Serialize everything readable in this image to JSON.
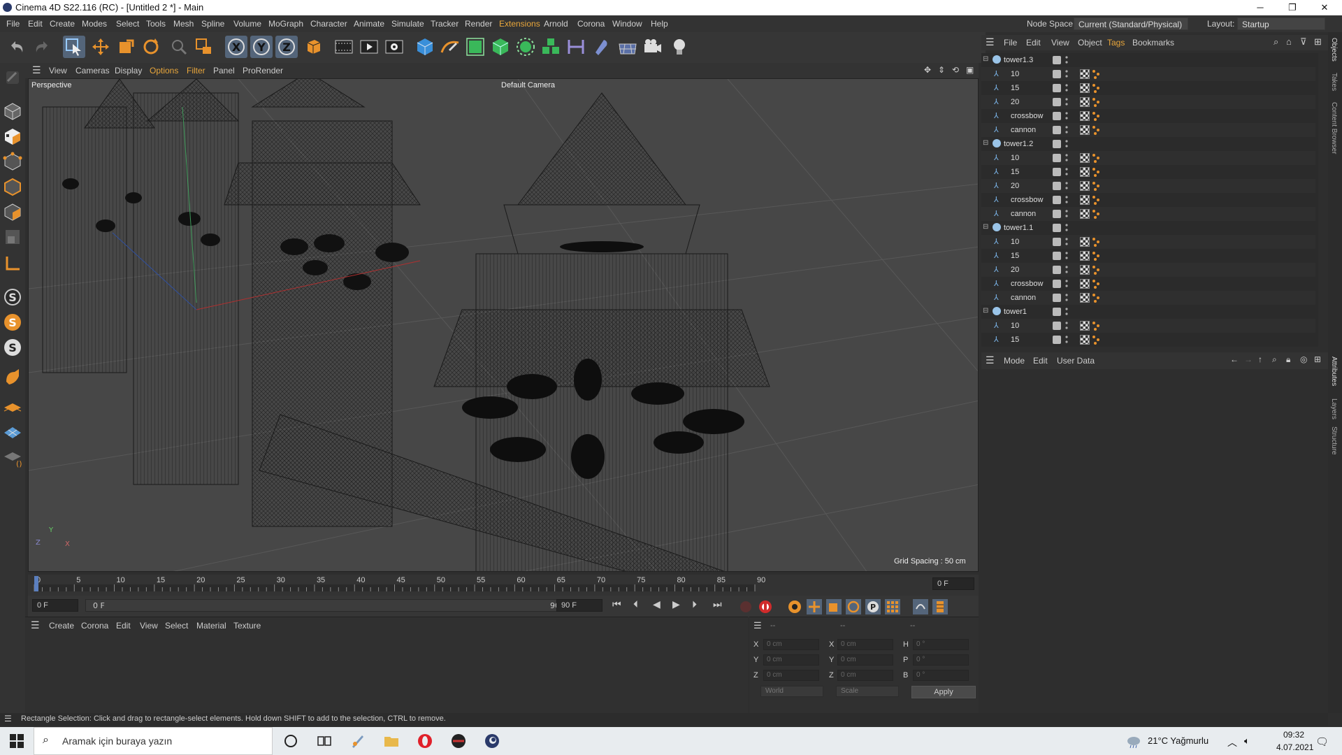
{
  "window": {
    "title": "Cinema 4D S22.116 (RC) - [Untitled 2 *] - Main",
    "controls": [
      "─",
      "❐",
      "✕"
    ]
  },
  "menubar": {
    "items": [
      "File",
      "Edit",
      "Create",
      "Modes",
      "Select",
      "Tools",
      "Mesh",
      "Spline",
      "Volume",
      "MoGraph",
      "Character",
      "Animate",
      "Simulate",
      "Tracker",
      "Render",
      "Extensions",
      "Arnold",
      "Corona",
      "Window",
      "Help"
    ],
    "node_space_label": "Node Space:",
    "node_space_value": "Current (Standard/Physical)",
    "layout_label": "Layout:",
    "layout_value": "Startup"
  },
  "viewport": {
    "menu": [
      "View",
      "Cameras",
      "Display",
      "Options",
      "Filter",
      "Panel",
      "ProRender"
    ],
    "view_name": "Perspective",
    "camera": "Default Camera",
    "grid_spacing": "Grid Spacing : 50 cm",
    "axis": {
      "y": "Y",
      "z": "Z",
      "x": "X"
    }
  },
  "timeline": {
    "ticks": [
      "0",
      "5",
      "10",
      "15",
      "20",
      "25",
      "30",
      "35",
      "40",
      "45",
      "50",
      "55",
      "60",
      "65",
      "70",
      "75",
      "80",
      "85",
      "90"
    ],
    "current_frame_display": "0 F"
  },
  "transport": {
    "start": "0 F",
    "range_start": "0 F",
    "range_end": "90 F",
    "end": "90 F"
  },
  "material_manager": {
    "menu": [
      "Create",
      "Corona",
      "Edit",
      "View",
      "Select",
      "Material",
      "Texture"
    ]
  },
  "coordinates": {
    "headers": [
      "--",
      "--",
      "--"
    ],
    "rows": [
      {
        "a": "X",
        "a_val": "0 cm",
        "b": "X",
        "b_val": "0 cm",
        "c": "H",
        "c_val": "0 °"
      },
      {
        "a": "Y",
        "a_val": "0 cm",
        "b": "Y",
        "b_val": "0 cm",
        "c": "P",
        "c_val": "0 °"
      },
      {
        "a": "Z",
        "a_val": "0 cm",
        "b": "Z",
        "b_val": "0 cm",
        "c": "B",
        "c_val": "0 °"
      }
    ],
    "mode": "World",
    "size_mode": "Scale",
    "apply": "Apply"
  },
  "status": {
    "text": "Rectangle Selection: Click and drag to rectangle-select elements. Hold down SHIFT to add to the selection, CTRL to remove."
  },
  "objects_panel": {
    "menu": [
      "File",
      "Edit",
      "View",
      "Object",
      "Tags",
      "Bookmarks"
    ],
    "rows": [
      {
        "label": "tower1.3",
        "level": 0
      },
      {
        "label": "10",
        "level": 1
      },
      {
        "label": "15",
        "level": 1
      },
      {
        "label": "20",
        "level": 1
      },
      {
        "label": "crossbow",
        "level": 1
      },
      {
        "label": "cannon",
        "level": 1
      },
      {
        "label": "tower1.2",
        "level": 0
      },
      {
        "label": "10",
        "level": 1
      },
      {
        "label": "15",
        "level": 1
      },
      {
        "label": "20",
        "level": 1
      },
      {
        "label": "crossbow",
        "level": 1
      },
      {
        "label": "cannon",
        "level": 1
      },
      {
        "label": "tower1.1",
        "level": 0
      },
      {
        "label": "10",
        "level": 1
      },
      {
        "label": "15",
        "level": 1
      },
      {
        "label": "20",
        "level": 1
      },
      {
        "label": "crossbow",
        "level": 1
      },
      {
        "label": "cannon",
        "level": 1
      },
      {
        "label": "tower1",
        "level": 0
      },
      {
        "label": "10",
        "level": 1
      },
      {
        "label": "15",
        "level": 1
      }
    ]
  },
  "attributes_panel": {
    "menu": [
      "Mode",
      "Edit",
      "User Data"
    ]
  },
  "side_tabs": [
    "Objects",
    "Takes",
    "Content Browser",
    "Attributes",
    "Layers",
    "Structure"
  ],
  "taskbar": {
    "search_placeholder": "Aramak için buraya yazın",
    "weather": "21°C  Yağmurlu",
    "time": "09:32",
    "date": "4.07.2021"
  }
}
